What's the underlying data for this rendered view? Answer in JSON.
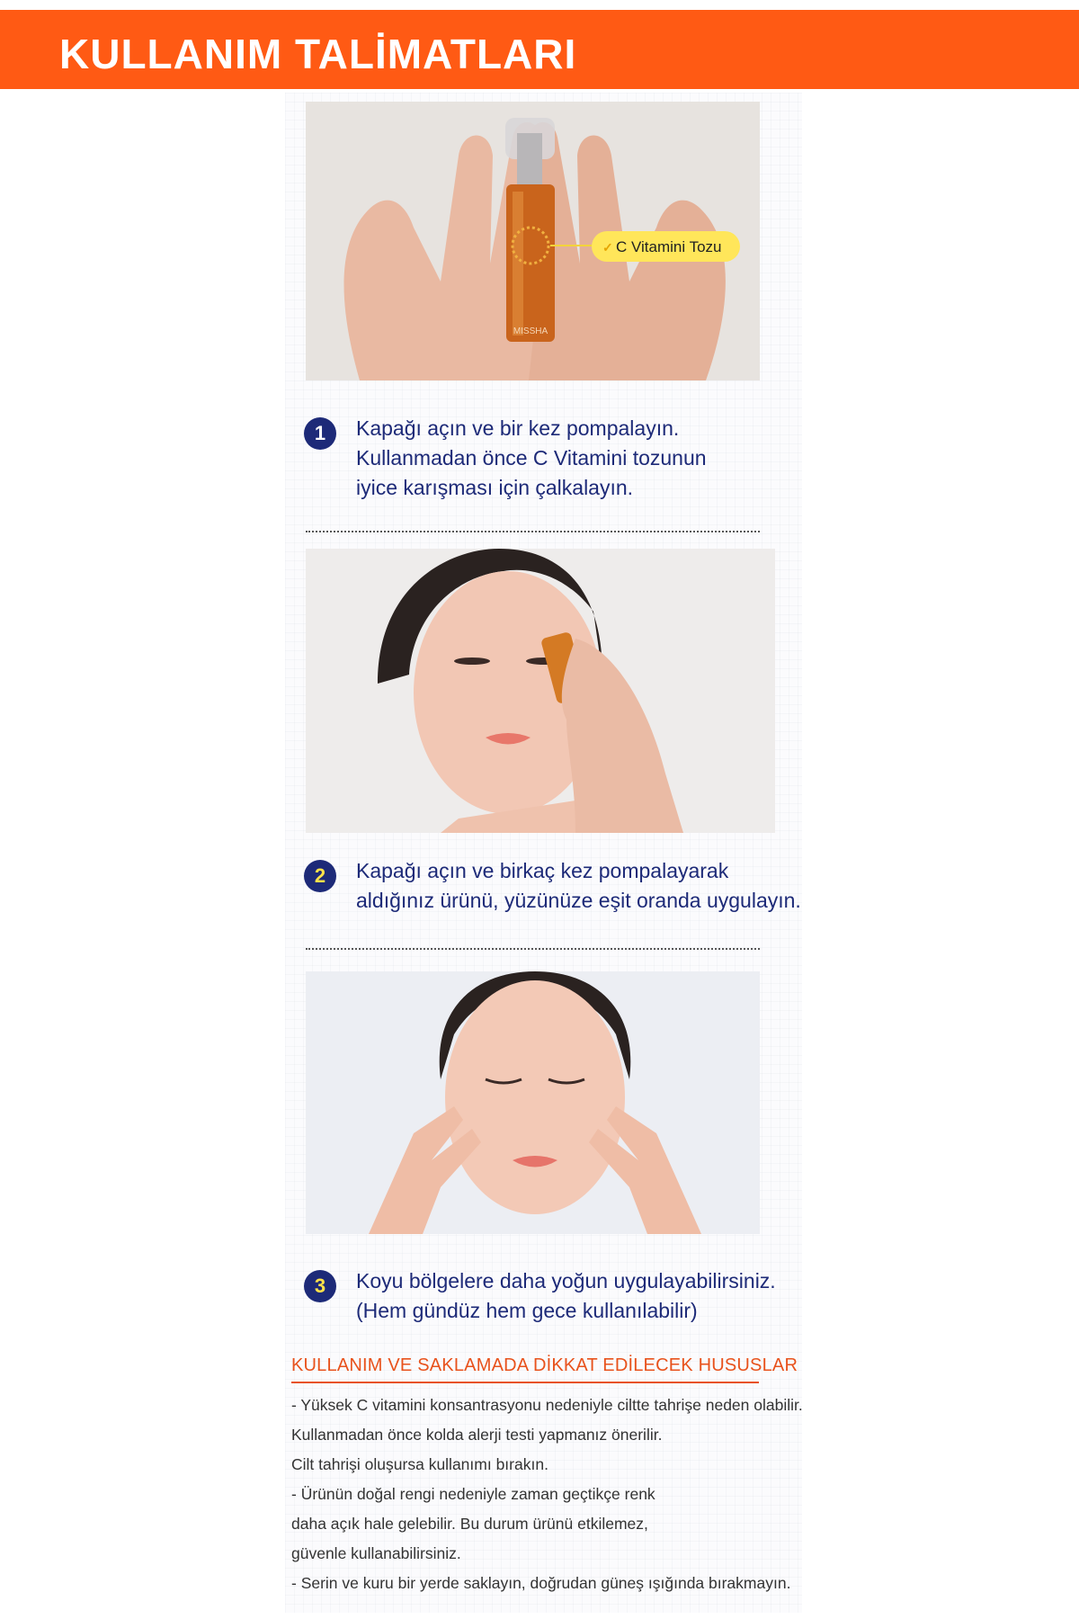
{
  "header": {
    "title": "KULLANIM TALİMATLARI",
    "color": "#ff5a14"
  },
  "images": {
    "bottle_label": "C Vitamini Tozu",
    "bottle_brand": "MISSHA"
  },
  "steps": [
    {
      "number": "1",
      "lines": [
        "Kapağı açın ve bir kez pompalayın.",
        "Kullanmadan önce C Vitamini tozunun",
        "iyice karışması için çalkalayın."
      ]
    },
    {
      "number": "2",
      "lines": [
        "Kapağı açın ve birkaç kez pompalayarak",
        "aldığınız ürünü, yüzünüze eşit oranda uygulayın."
      ]
    },
    {
      "number": "3",
      "lines": [
        "Koyu bölgelere daha yoğun uygulayabilirsiniz.",
        "(Hem gündüz hem gece kullanılabilir)"
      ]
    }
  ],
  "caution": {
    "title": "KULLANIM VE SAKLAMADA DİKKAT EDİLECEK HUSUSLAR",
    "lines": [
      "- Yüksek C vitamini konsantrasyonu nedeniyle ciltte tahrişe neden olabilir.",
      "Kullanmadan önce kolda alerji testi yapmanız önerilir.",
      "Cilt tahrişi oluşursa kullanımı bırakın.",
      "- Ürünün doğal rengi nedeniyle zaman geçtikçe renk",
      "daha açık hale gelebilir. Bu durum ürünü etkilemez,",
      "güvenle kullanabilirsiniz.",
      "- Serin ve kuru bir yerde saklayın, doğrudan güneş ışığında bırakmayın."
    ]
  },
  "colors": {
    "accent": "#ff5a14",
    "navy": "#1d2a78",
    "badge_yellow": "#ffe14a",
    "caution": "#e8521c"
  }
}
